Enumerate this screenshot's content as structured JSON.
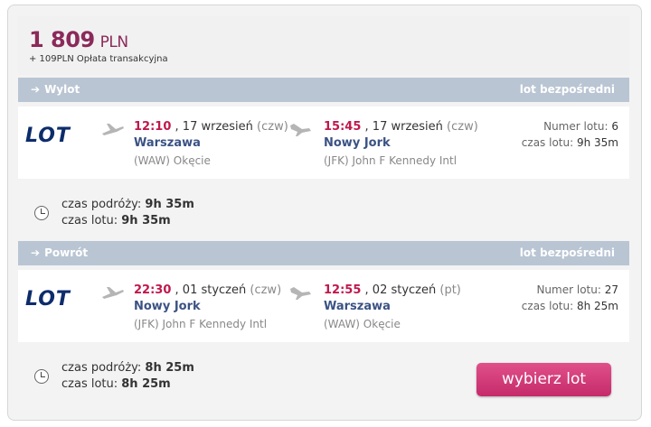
{
  "price": {
    "amount": "1 809",
    "currency": "PLN",
    "fee": "+ 109PLN Opłata transakcyjna"
  },
  "outbound": {
    "header": "Wylot",
    "direct": "lot bezpośredni",
    "airline": "LOT",
    "dep": {
      "time": "12:10",
      "date": ", 17 wrzesień",
      "day": "(czw)",
      "city": "Warszawa",
      "airport": "(WAW) Okęcie"
    },
    "arr": {
      "time": "15:45",
      "date": ", 17 wrzesień",
      "day": "(czw)",
      "city": "Nowy Jork",
      "airport": "(JFK) John F Kennedy Intl"
    },
    "flight_no_label": "Numer lotu:",
    "flight_no": "6",
    "duration_label": "czas lotu:",
    "duration": "9h 35m",
    "summary": {
      "travel_label": "czas podróży:",
      "travel": "9h 35m",
      "flight_label": "czas lotu:",
      "flight": "9h 35m"
    }
  },
  "return": {
    "header": "Powrót",
    "direct": "lot bezpośredni",
    "airline": "LOT",
    "dep": {
      "time": "22:30",
      "date": ", 01 styczeń",
      "day": "(czw)",
      "city": "Nowy Jork",
      "airport": "(JFK) John F Kennedy Intl"
    },
    "arr": {
      "time": "12:55",
      "date": ", 02 styczeń",
      "day": "(pt)",
      "city": "Warszawa",
      "airport": "(WAW) Okęcie"
    },
    "flight_no_label": "Numer lotu:",
    "flight_no": "27",
    "duration_label": "czas lotu:",
    "duration": "8h 25m",
    "summary": {
      "travel_label": "czas podróży:",
      "travel": "8h 25m",
      "flight_label": "czas lotu:",
      "flight": "8h 25m"
    }
  },
  "select_button": "wybierz lot",
  "colors": {
    "accent": "#c0184c",
    "header_bg": "#b9c5d3",
    "city": "#3b5284"
  },
  "icons": [
    "plane-departure-icon",
    "plane-arrival-icon",
    "clock-icon",
    "arrow-right-icon"
  ]
}
